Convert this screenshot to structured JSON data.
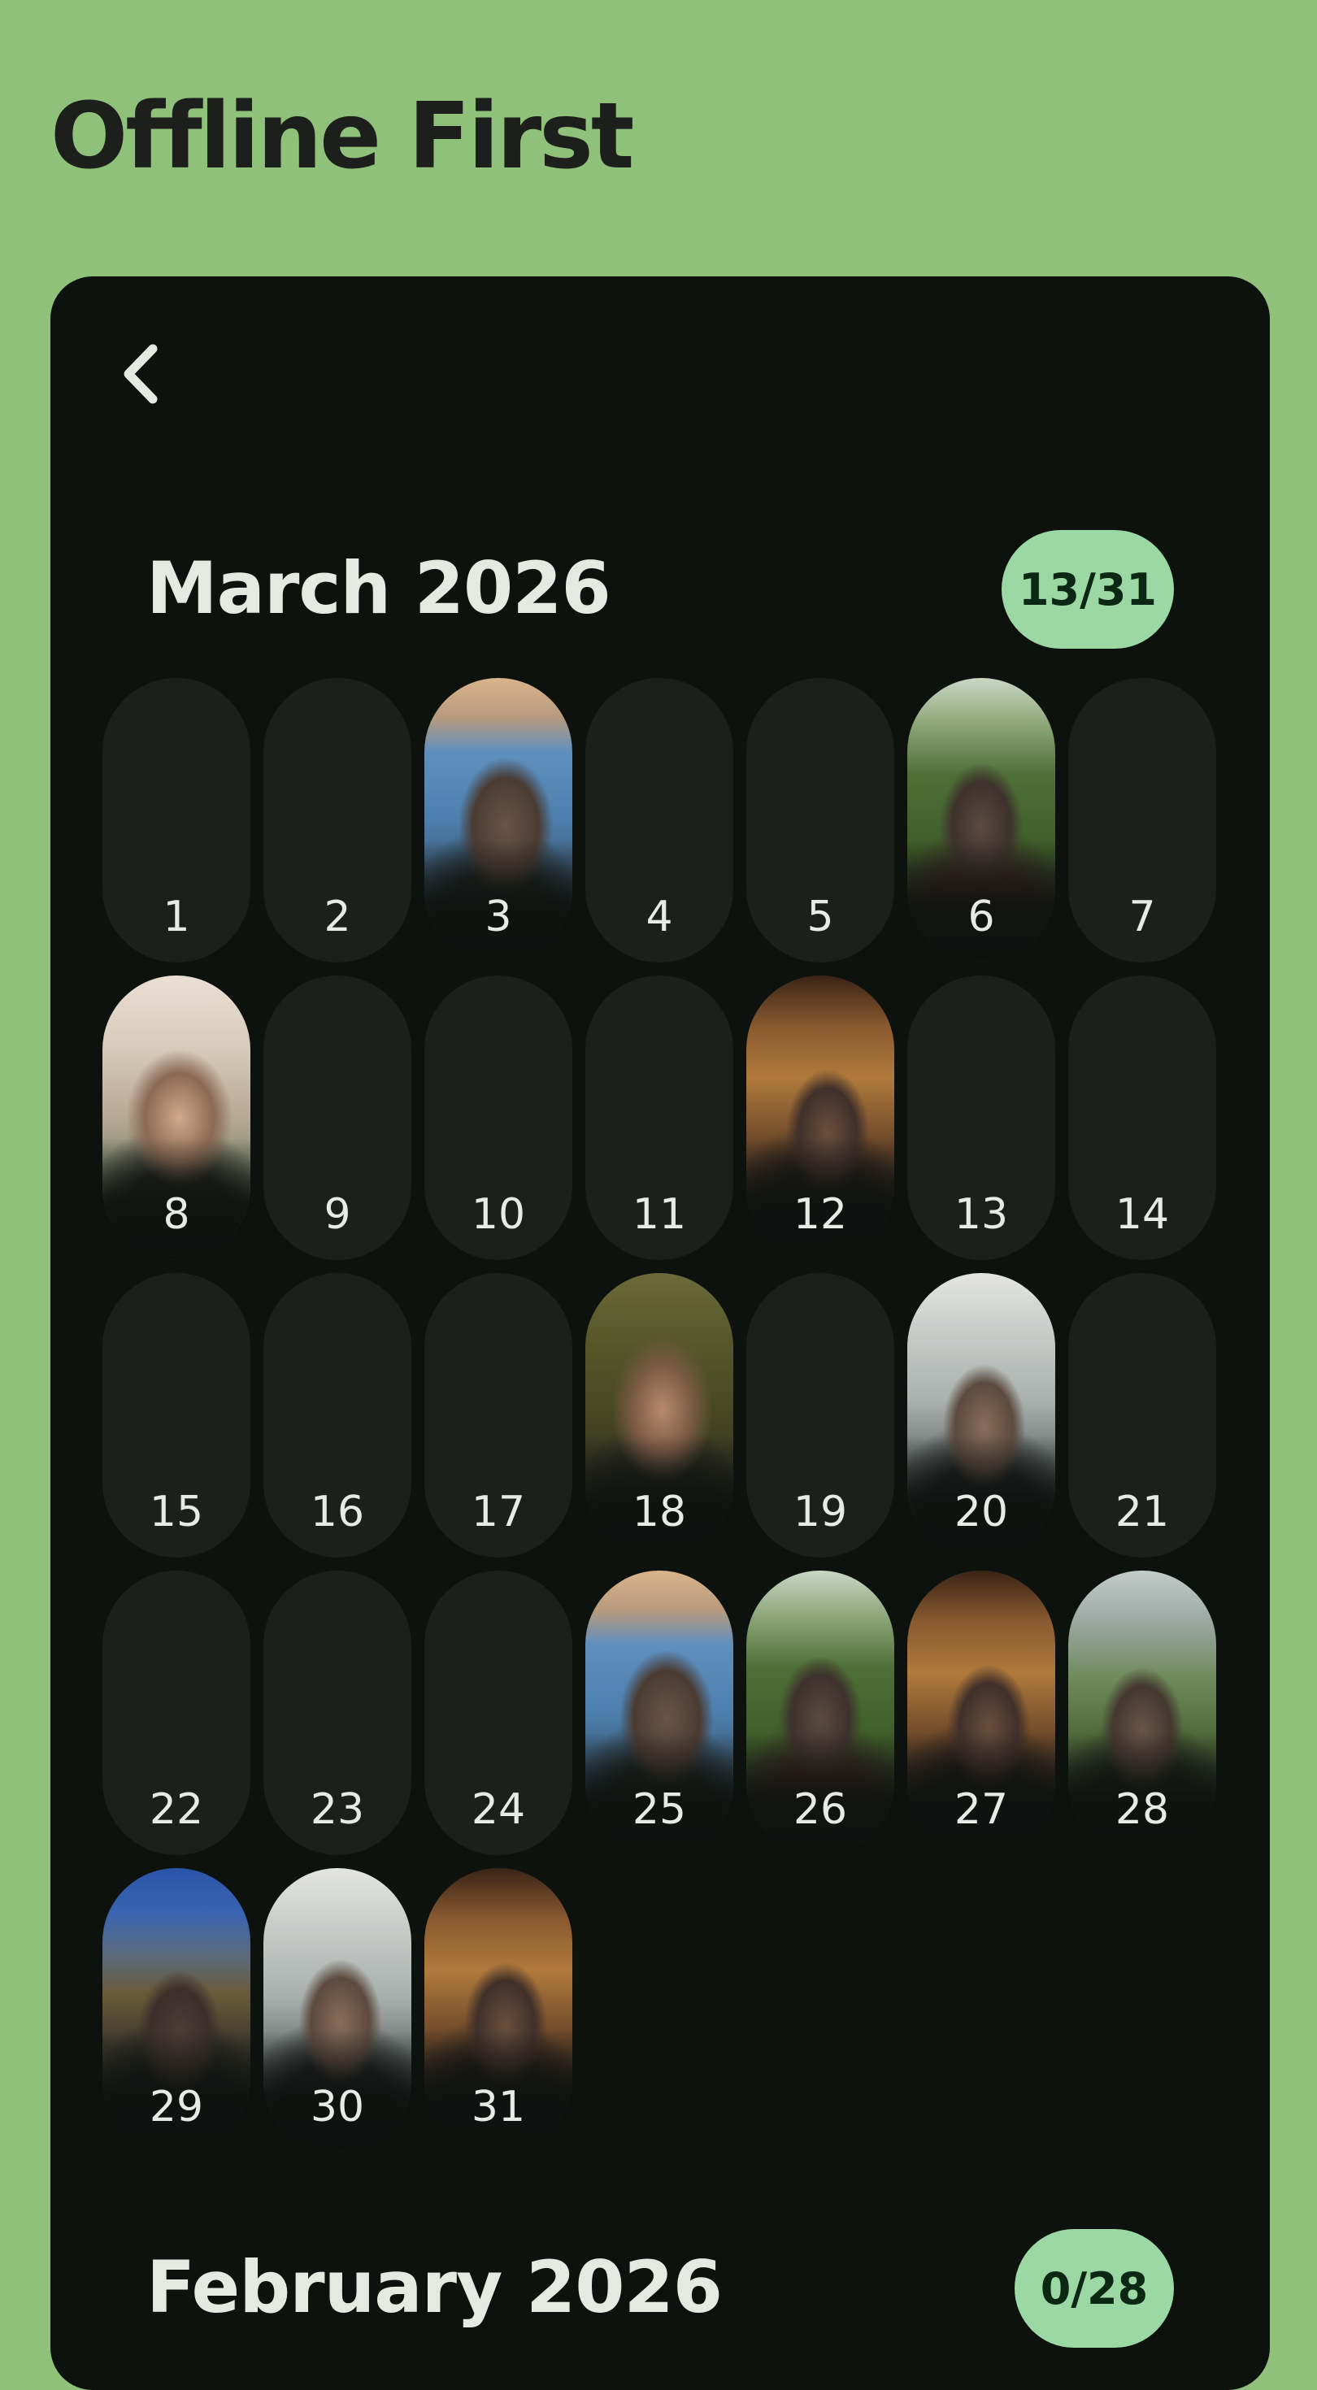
{
  "app": {
    "title": "Offline First"
  },
  "months": [
    {
      "title": "March 2026",
      "count": "13/31",
      "days": [
        {
          "label": "1",
          "photo": null
        },
        {
          "label": "2",
          "photo": null
        },
        {
          "label": "3",
          "photo": "blue-kitchen"
        },
        {
          "label": "4",
          "photo": null
        },
        {
          "label": "5",
          "photo": null
        },
        {
          "label": "6",
          "photo": "garden"
        },
        {
          "label": "7",
          "photo": null
        },
        {
          "label": "8",
          "photo": "cream-room"
        },
        {
          "label": "9",
          "photo": null
        },
        {
          "label": "10",
          "photo": null
        },
        {
          "label": "11",
          "photo": null
        },
        {
          "label": "12",
          "photo": "warm-interior"
        },
        {
          "label": "13",
          "photo": null
        },
        {
          "label": "14",
          "photo": null
        },
        {
          "label": "15",
          "photo": null
        },
        {
          "label": "16",
          "photo": null
        },
        {
          "label": "17",
          "photo": null
        },
        {
          "label": "18",
          "photo": "garden-dark"
        },
        {
          "label": "19",
          "photo": null
        },
        {
          "label": "20",
          "photo": "white-office"
        },
        {
          "label": "21",
          "photo": null
        },
        {
          "label": "22",
          "photo": null
        },
        {
          "label": "23",
          "photo": null
        },
        {
          "label": "24",
          "photo": null
        },
        {
          "label": "25",
          "photo": "blue-kitchen"
        },
        {
          "label": "26",
          "photo": "garden"
        },
        {
          "label": "27",
          "photo": "warm-interior"
        },
        {
          "label": "28",
          "photo": "greenhouse"
        },
        {
          "label": "29",
          "photo": "night-sky"
        },
        {
          "label": "30",
          "photo": "white-office"
        },
        {
          "label": "31",
          "photo": "warm-interior"
        }
      ]
    },
    {
      "title": "February 2026",
      "count": "0/28",
      "days": []
    }
  ],
  "colors": {
    "background": "#90c17b",
    "panel": "#0e120f",
    "empty_day": "#1c201c",
    "badge": "#9bd8a4",
    "badge_text": "#0c2815",
    "text_light": "#e6e9e2"
  },
  "icons": {
    "back": "chevron-left-icon"
  }
}
